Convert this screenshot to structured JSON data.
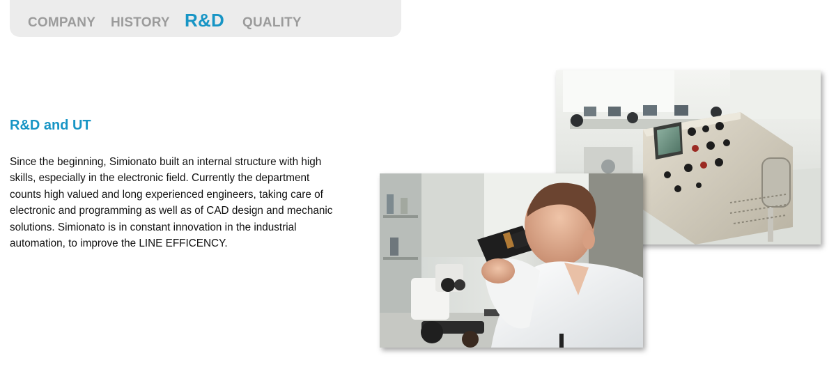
{
  "nav": {
    "tabs": [
      {
        "label": "COMPANY",
        "active": false
      },
      {
        "label": "HISTORY",
        "active": false
      },
      {
        "label": "R&D",
        "active": true
      },
      {
        "label": "QUALITY",
        "active": false
      }
    ]
  },
  "main": {
    "title": "R&D and UT",
    "body_lines": [
      "Since the beginning, Simionato built an internal structure with high",
      "skills, especially in the electronic field. Currently the department",
      "counts high valued and long experienced engineers, taking care of",
      "electronic and programming as well as of CAD design and mechanic",
      "solutions. Simionato is in constant innovation in the industrial",
      "automation, to improve the LINE EFFICENCY."
    ]
  },
  "colors": {
    "accent": "#1795c5",
    "tab_inactive": "#9b9b9b",
    "tabbar_bg": "#ececec"
  },
  "images": {
    "lab_photo": "photo-oscilloscope-lab",
    "scientist_photo": "photo-scientist-microscope"
  }
}
